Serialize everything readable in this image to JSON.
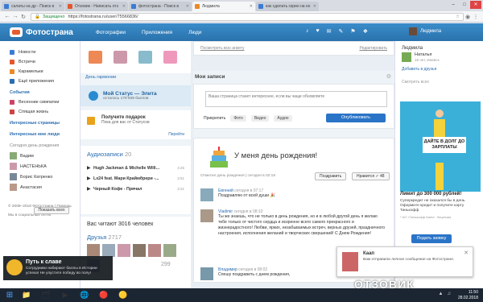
{
  "browser": {
    "tabs": [
      {
        "label": "салаты на др - Поиск в",
        "color": "#3a7bd5",
        "active": false
      },
      {
        "label": "Отзовик - Написать отз",
        "color": "#e4572e",
        "active": false
      },
      {
        "label": "фотострана - Поиск в",
        "color": "#3a7bd5",
        "active": false
      },
      {
        "label": "Людмила",
        "color": "#e88a2a",
        "active": true
      },
      {
        "label": "как сделать скрин на но",
        "color": "#3a7bd5",
        "active": false
      }
    ],
    "secure_label": "Защищено",
    "url": "https://fotostrana.ru/user/75566836/"
  },
  "header": {
    "logo": "Фотострана",
    "nav": [
      "Фотографии",
      "Приложения",
      "Люди"
    ],
    "icons": [
      "♪",
      "♥",
      "✉",
      "✎",
      "⚑",
      "❖"
    ],
    "user_name": "Людмила"
  },
  "left": {
    "items": [
      {
        "label": "Новости",
        "color": "#3a7bd5"
      },
      {
        "label": "Встречи",
        "color": "#e4572e"
      },
      {
        "label": "Карамельки",
        "color": "#e88a2a"
      },
      {
        "label": "Ещё приложения",
        "color": "#2a6db0"
      }
    ],
    "events_title": "События",
    "events": [
      {
        "label": "Весенние симпатии",
        "color": "#c46"
      },
      {
        "label": "Спящая жизнь",
        "color": "#c44"
      }
    ],
    "pages_title": "Интересные страницы",
    "my_title": "Интересные мне люди",
    "recent_bday_title": "Сегодня день рождения",
    "friends": [
      "Вадим",
      "НАСТЕНЬКА",
      "Борис Катренко",
      "Анастасия"
    ],
    "show_all": "Показать всех",
    "footer": "© 2008–2018 Фотострана | Помощь",
    "footer2": "Мы в социальных сетях:"
  },
  "middle": {
    "day_label": "День гармонии",
    "gift_colors": [
      "#e85",
      "#c9a",
      "#8bc",
      "#e9b"
    ],
    "status_title": "Мой Статус — Элита",
    "status_sub": "осталось 179 849 баллов",
    "gift_title": "Получите подарок",
    "gift_sub": "Пока для вас от Статусов",
    "gift_go": "Перейти",
    "audio_title": "Аудиозаписи",
    "audio_count": "20",
    "tracks": [
      {
        "name": "Hugh Jackman & Michelle Willi...",
        "dur": "4:25"
      },
      {
        "name": "Lx24 feat. Мари Краймбрери -...",
        "dur": "3:51"
      },
      {
        "name": "Черный Кофе - Прячал",
        "dur": "3:21"
      }
    ],
    "readers": "Вас читают 3016 человек",
    "friends_label": "Друзья",
    "friends_count": "2717",
    "friends_more": "299"
  },
  "center": {
    "top_link": "Посмотреть всю анкету",
    "top_edit": "Редактировать",
    "wall_title": "Мои записи",
    "wall_placeholder": "Ваша страница станет интереснее, если вы чаще обновляете",
    "attach_label": "Прикрепить",
    "attach_items": [
      "Фото",
      "Видео",
      "Аудио"
    ],
    "publish": "Опубликовать",
    "bday_title": "У меня день рождения!",
    "bday_meta": "Отметил день рождения | сегодня в 02:18",
    "congrat_btn": "Поздравить",
    "like_btn": "Нравится ✓ 48",
    "comments": [
      {
        "name": "Евгений",
        "time": "сегодня в 07:17",
        "text": "Поздравляю от всей души 🎉"
      },
      {
        "name": "Vladimir",
        "time": "сегодня в 08:10",
        "text": "Ты же знаешь, что не только в день рождения, но и в любой другой день я желаю тебе только от чистого сердца и искренне всего самого прекрасного и жизнерадостного! Любви, ярких, незабываемых встреч, верных друзей, праздничного настроения, исполнения желаний и творческих свершений! С Днем Рождения!"
      },
      {
        "name": "Владимир",
        "time": "сегодня в 08:02",
        "text": "Спешу поздравить с днем рождения,"
      }
    ]
  },
  "right": {
    "top_name": "Людмила",
    "top_link": "Добавить в друзья",
    "friend_name": "Наталья",
    "friend_city": "18 лет, Ижевск",
    "friend_link": "Добавить в друзья",
    "more_link": "Смотреть всех",
    "ad_sign": "ДАЙТЕ В ДОЛГ ДО ЗАРПЛАТЫ",
    "ad_title": "Лимит до 300 000 рублей!",
    "ad_text": "Суперкредит не оказался бы в день. Оформите кредит и получите карту Тинькофф",
    "ad_fine": "* АО «Тинькофф Банк». Лицензия",
    "ad_button": "Подать заявку"
  },
  "notifications": {
    "left_title": "Путь к славе",
    "left_body": "Сотрудники набирают баллы в Истории успеха! Не упустите победу во полу!",
    "right_name": "Каап",
    "right_body": "Вам отправили личное сообщение на Фотостране."
  },
  "taskbar": {
    "apps": [
      "📁",
      "🗂",
      "▶",
      "🌐",
      "🔴",
      "🟡"
    ],
    "watermark": "ОТЗОВИК",
    "time": "11:50",
    "date": "28.02.2018"
  }
}
